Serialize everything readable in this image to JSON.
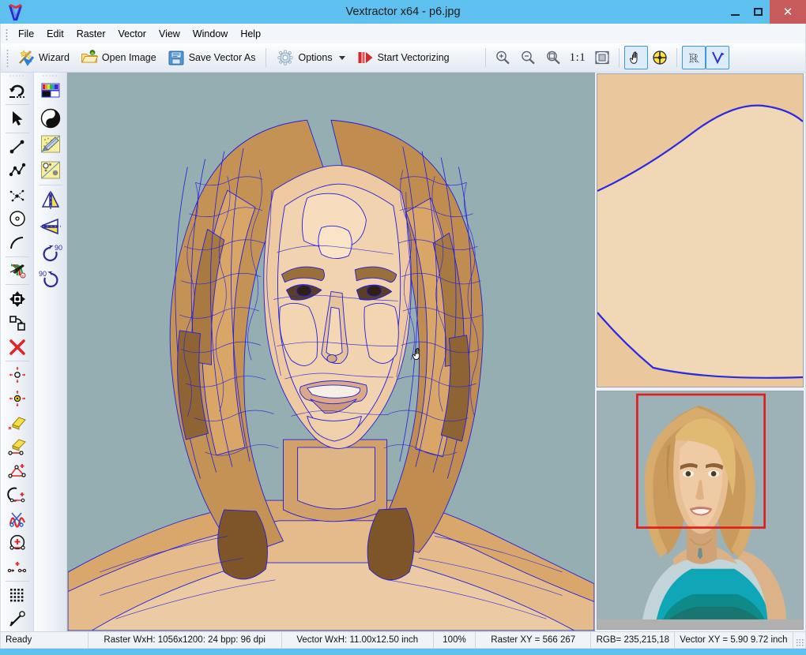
{
  "window": {
    "title": "Vextractor x64 - p6.jpg",
    "logo_icon": "vextractor-logo-icon",
    "minimize_label": "–",
    "maximize_label": "❐",
    "close_label": "✕"
  },
  "menu": {
    "items": [
      {
        "label": "File"
      },
      {
        "label": "Edit"
      },
      {
        "label": "Raster"
      },
      {
        "label": "Vector"
      },
      {
        "label": "View"
      },
      {
        "label": "Window"
      },
      {
        "label": "Help"
      }
    ]
  },
  "toolbar": {
    "buttons": [
      {
        "label": "Wizard",
        "icon": "wizard-wand-icon"
      },
      {
        "label": "Open Image",
        "icon": "open-folder-icon"
      },
      {
        "label": "Save Vector As",
        "icon": "floppy-disk-icon"
      },
      {
        "label": "Options",
        "icon": "gear-icon",
        "has_dropdown": true
      },
      {
        "label": "Start Vectorizing",
        "icon": "play-icon"
      }
    ],
    "zoom_in": "zoom-in-icon",
    "zoom_out": "zoom-out-icon",
    "zoom_rect": "zoom-region-icon",
    "zoom_actual_label": "1:1",
    "zoom_fit": "fit-to-window-icon",
    "pan_tool": "hand-pan-icon",
    "pan_tool_active": true,
    "center_tool": "crosshair-target-icon",
    "raster_layer_label": "R",
    "raster_layer_active": true,
    "vector_layer_label": "V",
    "vector_layer_active": true
  },
  "left_tools": {
    "column1": [
      {
        "name": "undo-tool",
        "icon": "undo-arrow-icon"
      },
      {
        "name": "select-tool",
        "icon": "arrow-pointer-icon"
      },
      {
        "name": "line-tool",
        "icon": "line-segment-icon"
      },
      {
        "name": "polyline-tool",
        "icon": "polyline-icon"
      },
      {
        "name": "spline-tool",
        "icon": "spline-node-icon"
      },
      {
        "name": "circle-tool",
        "icon": "circle-icon"
      },
      {
        "name": "arc-tool",
        "icon": "arc-icon"
      },
      {
        "name": "layers-tool",
        "icon": "layers-color-icon"
      },
      {
        "name": "move-tool",
        "icon": "move-object-icon"
      },
      {
        "name": "duplicate-tool",
        "icon": "duplicate-icon"
      },
      {
        "name": "delete-tool",
        "icon": "delete-x-icon"
      },
      {
        "name": "scale-tool",
        "icon": "scale-nodes-icon"
      },
      {
        "name": "transform-center-tool",
        "icon": "transform-center-icon"
      },
      {
        "name": "erase-tool",
        "icon": "eraser-icon"
      },
      {
        "name": "erase-segment-tool",
        "icon": "eraser-segment-icon"
      },
      {
        "name": "add-node-tool",
        "icon": "add-node-icon"
      },
      {
        "name": "arc-node-tool",
        "icon": "arc-add-node-icon"
      },
      {
        "name": "cut-curve-tool",
        "icon": "scissors-curve-icon"
      },
      {
        "name": "close-contour-tool",
        "icon": "close-contour-icon"
      },
      {
        "name": "join-tool",
        "icon": "join-nodes-icon"
      },
      {
        "name": "grid-tool",
        "icon": "grid-icon"
      },
      {
        "name": "snap-tool",
        "icon": "snap-arrow-icon"
      }
    ],
    "column2": [
      {
        "name": "palette-tool",
        "icon": "color-palette-icon"
      },
      {
        "name": "contrast-tool",
        "icon": "yin-yang-contrast-icon"
      },
      {
        "name": "despeckle-tool",
        "icon": "despeckle-icon"
      },
      {
        "name": "noise-filter-tool",
        "icon": "noise-filter-icon"
      },
      {
        "name": "mirror-vertical-tool",
        "icon": "mirror-vertical-icon"
      },
      {
        "name": "mirror-horizontal-tool",
        "icon": "mirror-horizontal-icon"
      },
      {
        "name": "rotate-cw-90-tool",
        "icon": "rotate-cw-90-icon",
        "label": "90"
      },
      {
        "name": "rotate-ccw-90-tool",
        "icon": "rotate-ccw-90-icon",
        "label": "90"
      }
    ]
  },
  "canvas": {
    "cursor": "hand-pan-cursor",
    "background_color": "#95aeb2",
    "vector_stroke_color": "#2020dd"
  },
  "panels": {
    "zoom_preview_name": "vector-zoom-preview",
    "thumbnail_name": "image-thumbnail-preview",
    "selection_rect_color": "#e01b1b"
  },
  "statusbar": {
    "ready": "Ready",
    "raster_size": "Raster WxH: 1056x1200: 24 bpp: 96 dpi",
    "vector_size": "Vector WxH: 11.00x12.50 inch",
    "zoom": "100%",
    "raster_xy": "Raster XY =  566  267",
    "rgb": "RGB= 235,215,18",
    "vector_xy": "Vector XY =  5.90  9.72 inch"
  }
}
